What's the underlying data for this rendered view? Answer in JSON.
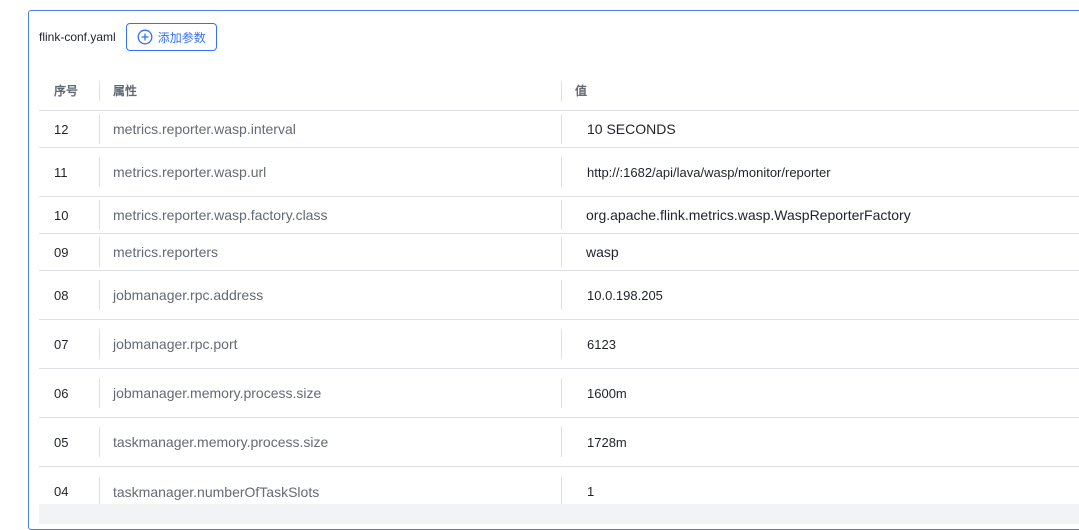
{
  "toolbar": {
    "file_label": "flink-conf.yaml",
    "add_label": "添加参数"
  },
  "table": {
    "columns": {
      "index": "序号",
      "property": "属性",
      "value": "值"
    },
    "rows": [
      {
        "index": "12",
        "property": "metrics.reporter.wasp.interval",
        "value": "10 SECONDS"
      },
      {
        "index": "11",
        "property": "metrics.reporter.wasp.url",
        "value": "http://:1682/api/lava/wasp/monitor/reporter"
      },
      {
        "index": "10",
        "property": "metrics.reporter.wasp.factory.class",
        "value": "org.apache.flink.metrics.wasp.WaspReporterFactory"
      },
      {
        "index": "09",
        "property": "metrics.reporters",
        "value": "wasp"
      },
      {
        "index": "08",
        "property": "jobmanager.rpc.address",
        "value": "10.0.198.205"
      },
      {
        "index": "07",
        "property": "jobmanager.rpc.port",
        "value": "6123"
      },
      {
        "index": "06",
        "property": "jobmanager.memory.process.size",
        "value": "1600m"
      },
      {
        "index": "05",
        "property": "taskmanager.memory.process.size",
        "value": "1728m"
      },
      {
        "index": "04",
        "property": "taskmanager.numberOfTaskSlots",
        "value": "1"
      }
    ]
  },
  "colors": {
    "accent": "#3370ff",
    "panel_border": "#4a7fe0",
    "row_border": "#dee0e3"
  },
  "icons": {
    "add": "plus-circle-icon"
  }
}
